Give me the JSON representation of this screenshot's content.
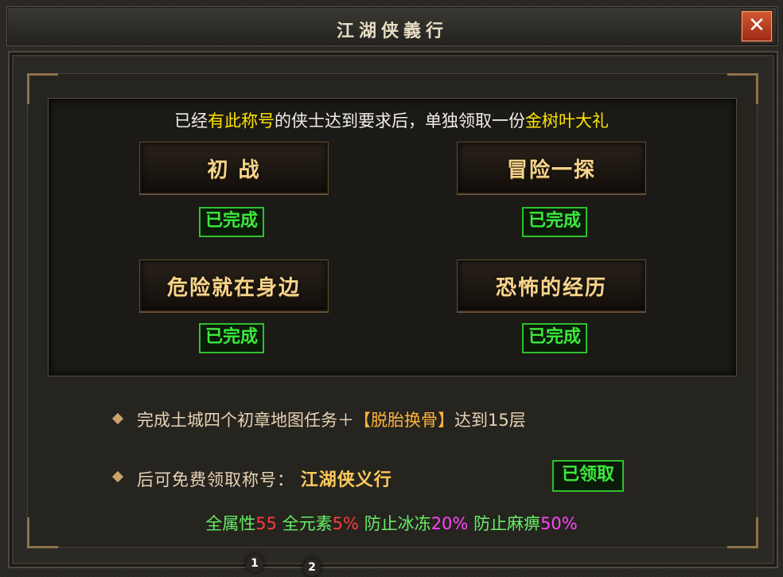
{
  "window": {
    "title": "江湖侠義行",
    "close_label": "✕"
  },
  "header": {
    "prefix": "已经",
    "hl1": "有此称号",
    "middle": "的侠士达到要求后，单独领取一份",
    "hl2": "金树叶大礼"
  },
  "tasks": [
    {
      "label": "初  战",
      "status": "已完成"
    },
    {
      "label": "冒险一探",
      "status": "已完成"
    },
    {
      "label": "危险就在身边",
      "status": "已完成"
    },
    {
      "label": "恐怖的经历",
      "status": "已完成"
    }
  ],
  "requirement": {
    "pre": "完成土城四个初章地图任务＋",
    "em": "【脱胎换骨】",
    "post": "达到15层"
  },
  "title_reward": {
    "prefix": "后可免费领取称号：",
    "name": "江湖侠义行",
    "button": "已领取"
  },
  "stats": [
    {
      "label": "全属性",
      "value": "55"
    },
    {
      "label": "全元素",
      "value": "5%"
    },
    {
      "label": "防止冰冻",
      "value": "20%"
    },
    {
      "label": "防止麻痹",
      "value": "50%"
    }
  ],
  "pages": [
    "1",
    "2"
  ],
  "colors": {
    "highlight": "#ffe400",
    "done_green": "#3bea3b",
    "stat_green": "#66ee66",
    "stat_red": "#ff3b3b",
    "stat_pink": "#ff44ff"
  }
}
